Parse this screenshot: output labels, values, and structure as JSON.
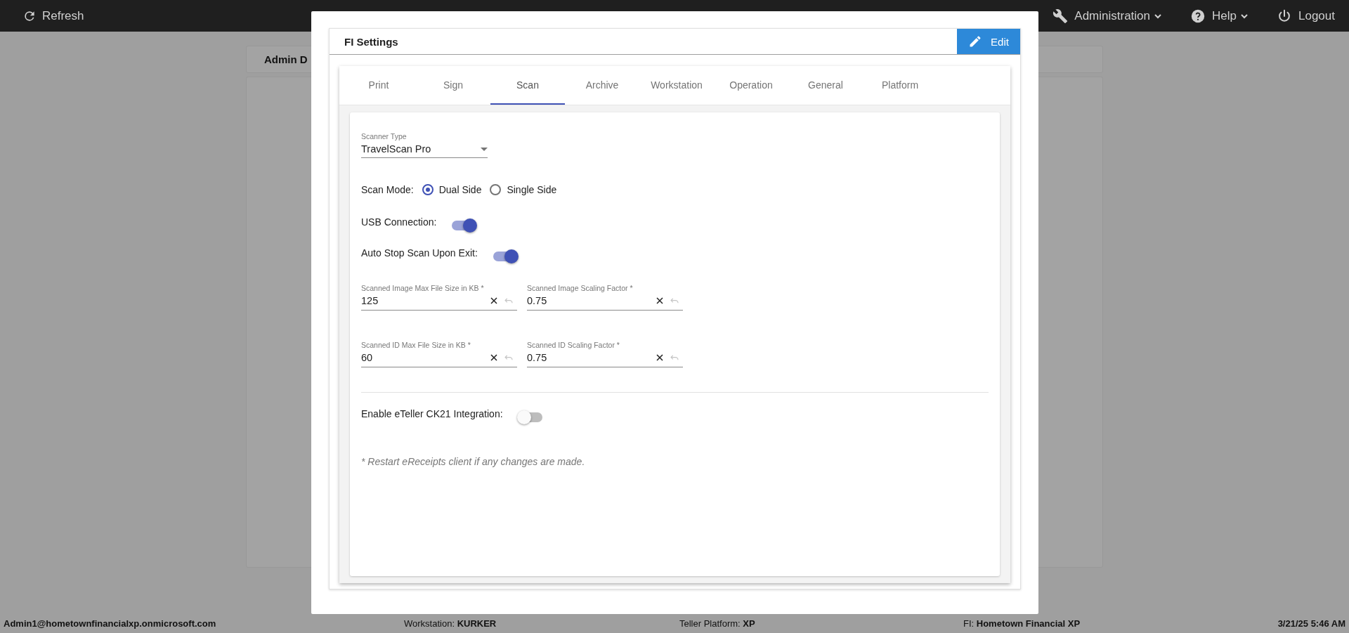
{
  "top_bar": {
    "refresh": "Refresh",
    "menus": [
      {
        "kind": "admin",
        "label": "Administration",
        "dropdown": true
      },
      {
        "kind": "help",
        "label": "Help",
        "dropdown": true
      },
      {
        "kind": "logout",
        "label": "Logout",
        "dropdown": false
      }
    ]
  },
  "background": {
    "card_title": "Admin D"
  },
  "dialog": {
    "title": "FI Settings",
    "edit_button": "Edit",
    "tabs": [
      {
        "label": "Print",
        "selected": false
      },
      {
        "label": "Sign",
        "selected": false
      },
      {
        "label": "Scan",
        "selected": true
      },
      {
        "label": "Archive",
        "selected": false
      },
      {
        "label": "Workstation",
        "selected": false
      },
      {
        "label": "Operation",
        "selected": false
      },
      {
        "label": "General",
        "selected": false
      },
      {
        "label": "Platform",
        "selected": false
      }
    ],
    "scanner_type": {
      "label": "Scanner Type",
      "value": "TravelScan Pro"
    },
    "scan_mode": {
      "label": "Scan Mode:",
      "options": [
        {
          "label": "Dual Side",
          "selected": true
        },
        {
          "label": "Single Side",
          "selected": false
        }
      ]
    },
    "toggles": [
      {
        "label": "USB Connection:",
        "on": true
      },
      {
        "label": "Auto Stop Scan Upon Exit:",
        "on": true
      }
    ],
    "fields": [
      {
        "label": "Scanned Image Max File Size in KB *",
        "value": "125"
      },
      {
        "label": "Scanned Image Scaling Factor *",
        "value": "0.75"
      },
      {
        "label": "Scanned ID Max File Size in KB *",
        "value": "60"
      },
      {
        "label": "Scanned ID Scaling Factor *",
        "value": "0.75"
      }
    ],
    "integration_toggle": {
      "label": "Enable eTeller CK21 Integration:",
      "on": false
    },
    "note": "* Restart eReceipts client if any changes are made."
  },
  "status_bar": {
    "user": "Admin1@hometownfinancialxp.onmicrosoft.com",
    "items": [
      "Workstation: **KURKER**",
      "Teller Platform: **XP**",
      "FI: **Hometown Financial XP**"
    ],
    "datetime": "3/21/25 5:46 AM"
  }
}
